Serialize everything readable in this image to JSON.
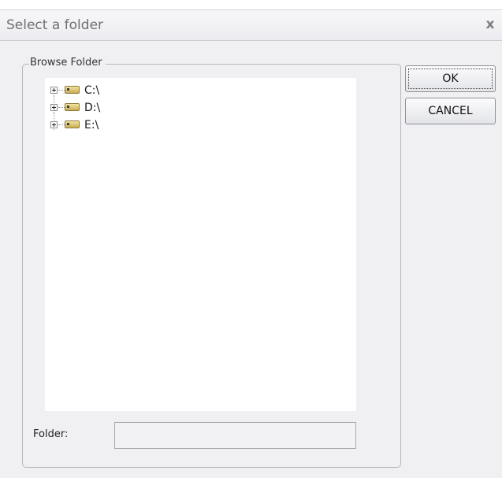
{
  "dialog": {
    "title": "Select a folder",
    "close_label": "x"
  },
  "browse": {
    "legend": "Browse Folder",
    "drives": [
      {
        "label": "C:\\",
        "icon": "drive-icon",
        "expander": "plus"
      },
      {
        "label": "D:\\",
        "icon": "drive-icon",
        "expander": "plus"
      },
      {
        "label": "E:\\",
        "icon": "drive-icon",
        "expander": "plus"
      }
    ]
  },
  "folder": {
    "label": "Folder:",
    "value": "",
    "placeholder": ""
  },
  "buttons": {
    "ok_label": "OK",
    "cancel_label": "CANCEL"
  }
}
